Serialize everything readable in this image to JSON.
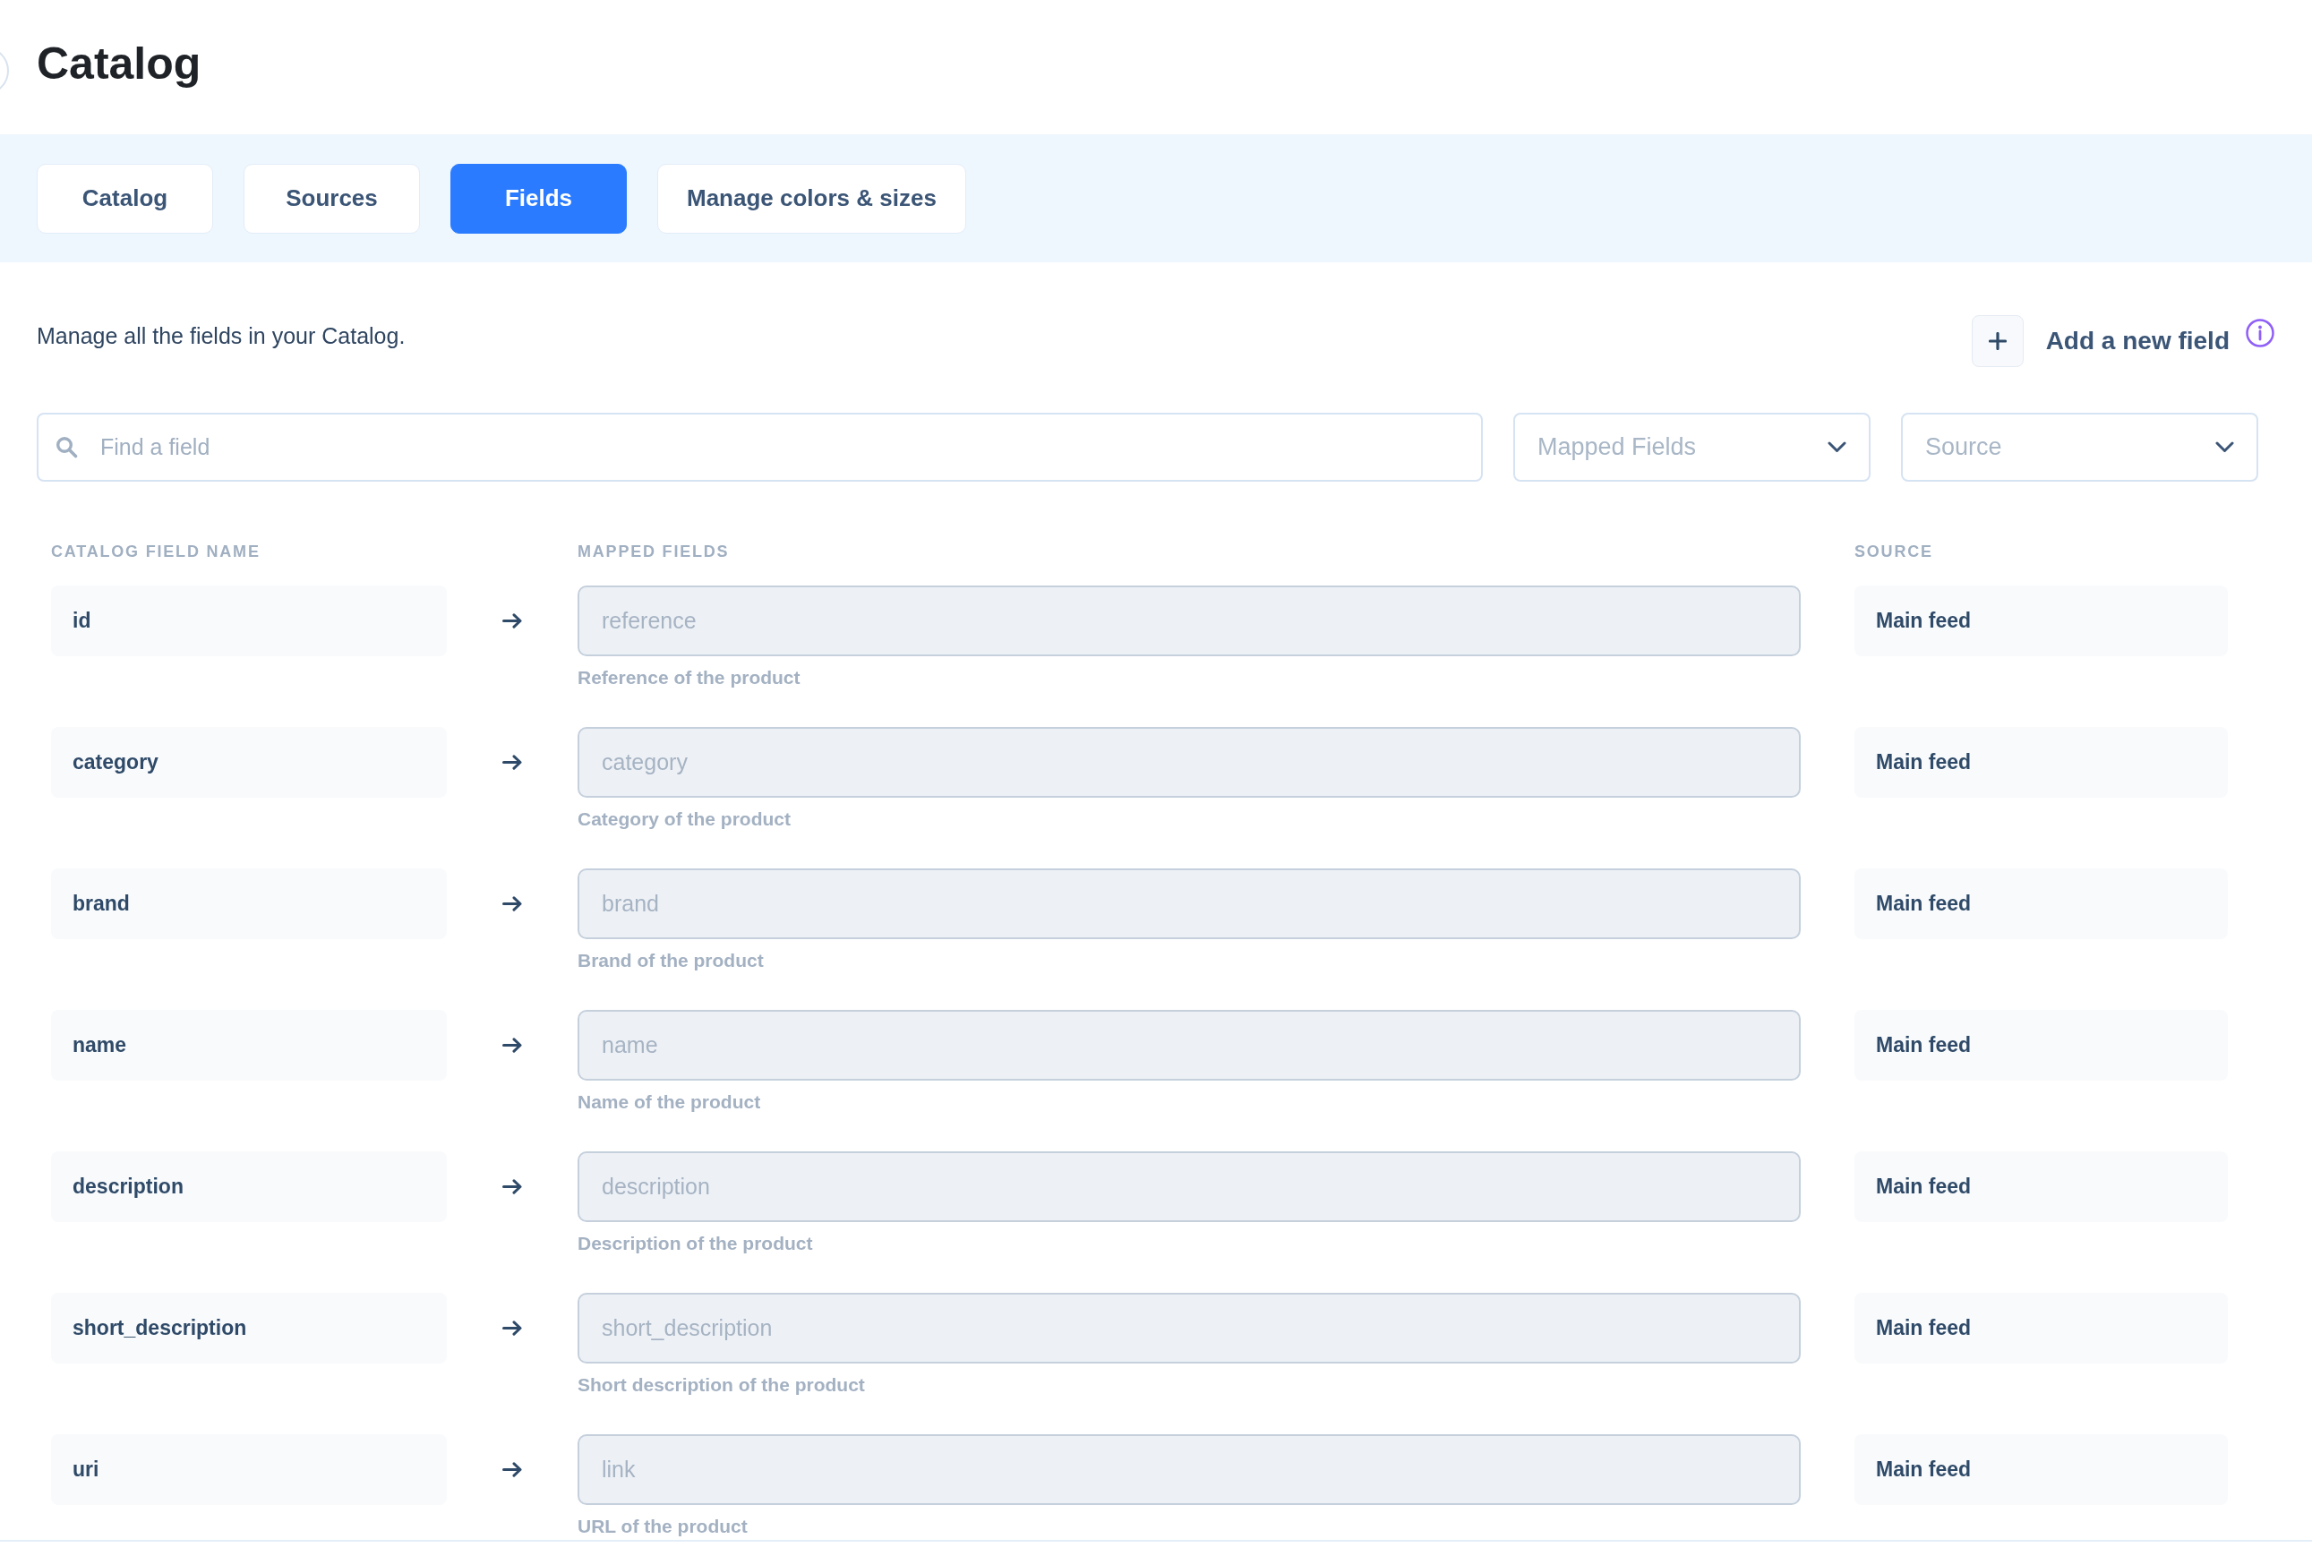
{
  "page": {
    "title": "Catalog"
  },
  "tabs": [
    {
      "label": "Catalog",
      "selected": false
    },
    {
      "label": "Sources",
      "selected": false
    },
    {
      "label": "Fields",
      "selected": true
    },
    {
      "label": "Manage colors & sizes",
      "selected": false
    }
  ],
  "intro": "Manage all the fields in your Catalog.",
  "add_field": {
    "label": "Add a new field"
  },
  "search": {
    "placeholder": "Find a field"
  },
  "filters": [
    {
      "placeholder": "Mapped Fields"
    },
    {
      "placeholder": "Source"
    }
  ],
  "table": {
    "columns": [
      "CATALOG FIELD NAME",
      "MAPPED FIELDS",
      "SOURCE"
    ],
    "rows": [
      {
        "name": "id",
        "mapped": {
          "placeholder": "reference"
        },
        "description": "Reference of the product",
        "source": "Main feed"
      },
      {
        "name": "category",
        "mapped": {
          "placeholder": "category"
        },
        "description": "Category of the product",
        "source": "Main feed"
      },
      {
        "name": "brand",
        "mapped": {
          "placeholder": "brand"
        },
        "description": "Brand of the product",
        "source": "Main feed"
      },
      {
        "name": "name",
        "mapped": {
          "placeholder": "name"
        },
        "description": "Name of the product",
        "source": "Main feed"
      },
      {
        "name": "description",
        "mapped": {
          "placeholder": "description"
        },
        "description": "Description of the product",
        "source": "Main feed"
      },
      {
        "name": "short_description",
        "mapped": {
          "placeholder": "short_description"
        },
        "description": "Short description of the product",
        "source": "Main feed"
      },
      {
        "name": "uri",
        "mapped": {
          "placeholder": "link"
        },
        "description": "URL of the product",
        "source": "Main feed"
      }
    ]
  }
}
